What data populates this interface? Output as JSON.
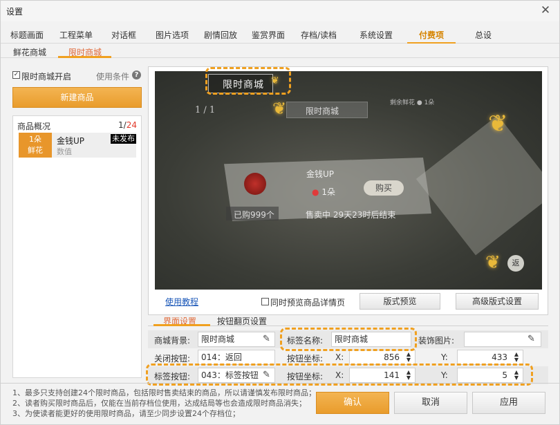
{
  "window": {
    "title": "设置",
    "close_glyph": "✕"
  },
  "main_tabs": [
    "标题画面",
    "工程菜单",
    "对话框",
    "图片选项",
    "剧情回放",
    "鉴赏界面",
    "存档/读档",
    "系统设置",
    "付费项",
    "总设"
  ],
  "main_tab_active": "付费项",
  "sub_tabs": [
    "鲜花商城",
    "限时商城"
  ],
  "sub_tab_active": "限时商城",
  "left": {
    "enable_label": "限时商城开启",
    "enable_checked": true,
    "conditions_label": "使用条件",
    "help_glyph": "?",
    "new_button": "新建商品",
    "overview_label": "商品概况",
    "count_current": "1/",
    "count_total": "24",
    "item": {
      "thumb_line1": "1朵",
      "thumb_line2": "鲜花",
      "name": "金钱UP",
      "sub": "数值",
      "badge": "未发布"
    }
  },
  "preview": {
    "title": "限时商城",
    "page": "1 / 1",
    "label": "限时商城",
    "remaining": "剩余鲜花 ● 1朵",
    "goods_name": "金钱UP",
    "price_dot": "●",
    "price": "1朵",
    "buy": "购买",
    "bought": "已购999个",
    "sale": "售卖中  29天23时后结束",
    "back": "返"
  },
  "preview_controls": {
    "tutorial_link": "使用教程",
    "sync_label": "同时预览商品详情页",
    "sync_checked": false,
    "layout_preview": "版式预览",
    "advanced_layout": "高级版式设置"
  },
  "settings_tabs": [
    "界面设置",
    "按钮翻页设置"
  ],
  "settings_tab_active": "界面设置",
  "settings": {
    "bg_label": "商城背景:",
    "bg_value": "限时商城",
    "tag_name_label": "标签名称:",
    "tag_name_value": "限时商城",
    "deco_label": "装饰图片:",
    "deco_value": "",
    "close_label": "关闭按钮:",
    "close_value": "014：返回",
    "btn_coord_label": "按钮坐标:",
    "close_x_label": "X:",
    "close_x": "856",
    "close_y_label": "Y:",
    "close_y": "433",
    "tag_btn_label": "标签按钮:",
    "tag_btn_value": "043：标签按钮",
    "tag_coord_label": "按钮坐标:",
    "tag_x_label": "X:",
    "tag_x": "141",
    "tag_y_label": "Y:",
    "tag_y": "5"
  },
  "notes": [
    "1、最多只支持创建24个限时商品，包括限时售卖结束的商品，所以请谨慎发布限时商品；",
    "2、读者购买限时商品后，仅能在当前存档位使用，达成结局等也会造成限时商品消失；",
    "3、为使读者能更好的使用限时商品，请至少同步设置24个存档位；"
  ],
  "footer": {
    "ok": "确认",
    "cancel": "取消",
    "apply": "应用"
  },
  "colors": {
    "accent": "#f0a020",
    "link": "#1a57b8",
    "count_total": "#e23a2a"
  }
}
